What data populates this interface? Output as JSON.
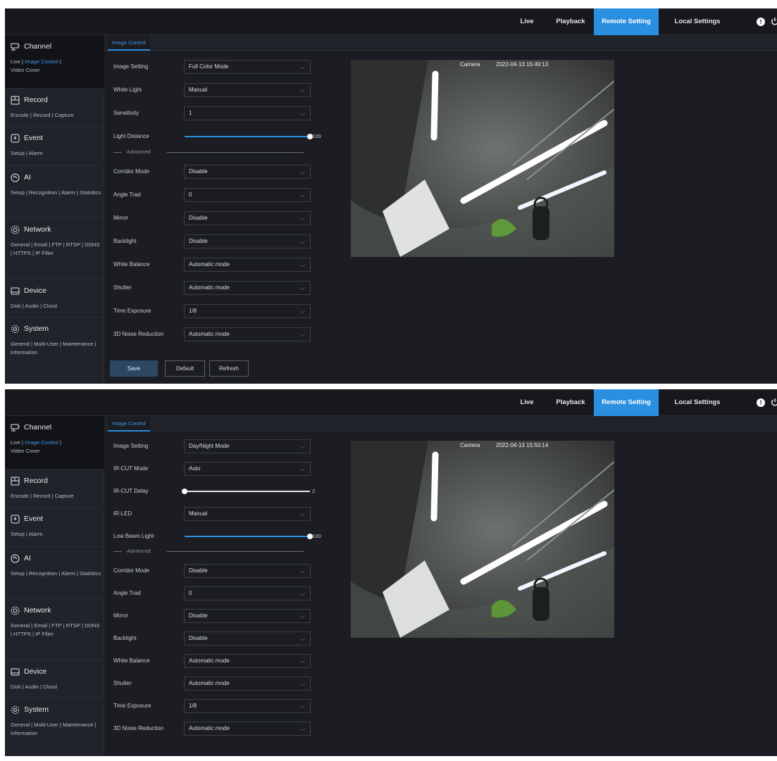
{
  "nav": {
    "live": "Live",
    "playback": "Playback",
    "remote_setting": "Remote Setting",
    "local_settings": "Local Settings",
    "alert_icon": "alert-icon",
    "power_icon": "power-icon",
    "active_color": "#2b8fe0"
  },
  "sidebar": {
    "channel": {
      "title": "Channel",
      "link_live": "Live |",
      "link_image_control": "Image Control",
      "link_sep": "|",
      "link_video_cover": "Video Cover"
    },
    "record": {
      "title": "Record",
      "links": "Encode | Record | Capture"
    },
    "event": {
      "title": "Event",
      "links": "Setup | Alarm"
    },
    "ai": {
      "title": "AI",
      "links": "Setup | Recognition | Alarm | Statistics"
    },
    "network": {
      "title": "Network",
      "links": "General | Email | FTP | RTSP | DDNS | HTTPS | IP Filter"
    },
    "device": {
      "title": "Device",
      "links": "Disk | Audio | Cloud"
    },
    "system": {
      "title": "System",
      "links": "General | Multi-User | Maintenance | Information"
    }
  },
  "tab": {
    "label": "Image Control"
  },
  "screen1": {
    "image_setting": {
      "label": "Image Setting",
      "value": "Full Color Mode"
    },
    "white_light": {
      "label": "White Light",
      "value": "Manual"
    },
    "sensitivity": {
      "label": "Sensitivity",
      "value": "1"
    },
    "light_distance": {
      "label": "Light Distance",
      "value": "100",
      "level": 1.0
    },
    "advanced": "Advanced",
    "corridor_mode": {
      "label": "Corridor Mode",
      "value": "Disable"
    },
    "angle_trad": {
      "label": "Angle Trad",
      "value": "0"
    },
    "mirror": {
      "label": "Mirror",
      "value": "Disable"
    },
    "backlight": {
      "label": "Backlight",
      "value": "Disable"
    },
    "white_balance": {
      "label": "White Balance",
      "value": "Automatic mode"
    },
    "shutter": {
      "label": "Shutter",
      "value": "Automatic mode"
    },
    "time_exposure": {
      "label": "Time Exposure",
      "value": "1/8"
    },
    "noise_reduction": {
      "label": "3D Noise Reduction",
      "value": "Automatic mode"
    },
    "buttons": {
      "save": "Save",
      "default": "Default",
      "refresh": "Refresh"
    },
    "camera_label": "Camera",
    "timestamp": "2022-04-13 15:49:13"
  },
  "screen2": {
    "image_setting": {
      "label": "Image Setting",
      "value": "Day/Night Mode"
    },
    "ir_cut_mode": {
      "label": "IR-CUT Mode",
      "value": "Auto"
    },
    "ir_cut_delay": {
      "label": "IR-CUT Delay",
      "value": "2",
      "level": 0.0
    },
    "ir_led": {
      "label": "IR-LED",
      "value": "Manual"
    },
    "low_beam_light": {
      "label": "Low Beam Light",
      "value": "100",
      "level": 1.0
    },
    "advanced": "Advanced",
    "corridor_mode": {
      "label": "Corridor Mode",
      "value": "Disable"
    },
    "angle_trad": {
      "label": "Angle Trad",
      "value": "0"
    },
    "mirror": {
      "label": "Mirror",
      "value": "Disable"
    },
    "backlight": {
      "label": "Backlight",
      "value": "Disable"
    },
    "white_balance": {
      "label": "White Balance",
      "value": "Automatic mode"
    },
    "shutter": {
      "label": "Shutter",
      "value": "Automatic mode"
    },
    "time_exposure": {
      "label": "Time Exposure",
      "value": "1/8"
    },
    "noise_reduction": {
      "label": "3D Noise Reduction",
      "value": "Automatic mode"
    },
    "camera_label": "Camera",
    "timestamp": "2022-04-13 15:50:14"
  }
}
